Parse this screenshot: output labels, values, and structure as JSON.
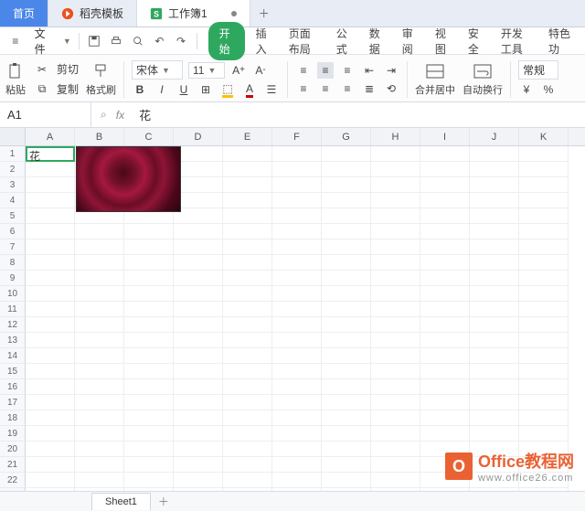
{
  "tabs": {
    "home": "首页",
    "templates": "稻壳模板",
    "workbook": "工作簿1"
  },
  "file_menu": "文件",
  "ribbon_tabs": [
    "开始",
    "插入",
    "页面布局",
    "公式",
    "数据",
    "审阅",
    "视图",
    "安全",
    "开发工具",
    "特色功"
  ],
  "clipboard": {
    "paste": "粘贴",
    "cut": "剪切",
    "copy": "复制",
    "format_painter": "格式刷"
  },
  "font": {
    "name": "宋体",
    "size": "11",
    "bold": "B",
    "italic": "I",
    "underline": "U"
  },
  "align": {
    "merge": "合并居中",
    "wrap": "自动换行"
  },
  "number": {
    "general": "常规"
  },
  "namebox": "A1",
  "formula": "花",
  "columns": [
    "A",
    "B",
    "C",
    "D",
    "E",
    "F",
    "G",
    "H",
    "I",
    "J",
    "K"
  ],
  "rowcount": 23,
  "cellA1": "花",
  "sheet": "Sheet1",
  "watermark": {
    "brand": "Office教程网",
    "url": "www.office26.com",
    "logo": "O"
  }
}
